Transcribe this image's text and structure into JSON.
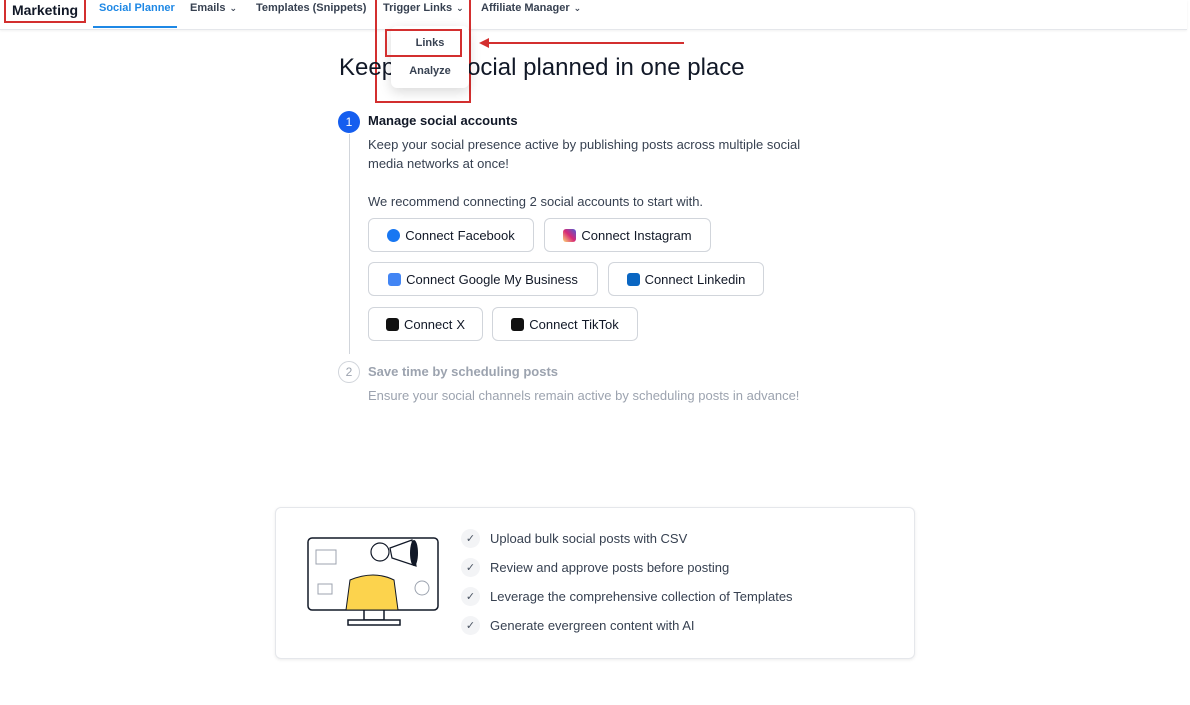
{
  "nav": {
    "brand": "Marketing",
    "items": [
      {
        "label": "Social Planner",
        "active": true
      },
      {
        "label": "Emails",
        "has_chevron": true
      },
      {
        "label": "Templates (Snippets)"
      },
      {
        "label": "Trigger Links",
        "has_chevron": true
      },
      {
        "label": "Affiliate Manager",
        "has_chevron": true
      }
    ],
    "dropdown": [
      "Links",
      "Analyze"
    ]
  },
  "page": {
    "heading": "Keep your social planned in one place"
  },
  "step1": {
    "number": "1",
    "title": "Manage social accounts",
    "desc_line1": "Keep your social presence active by publishing posts across multiple social",
    "desc_line2": "media networks at once!",
    "recommend": "We recommend connecting 2 social accounts to start with.",
    "buttons": [
      {
        "prefix": "Connect",
        "name": "Facebook",
        "icon": "facebook-icon"
      },
      {
        "prefix": "Connect",
        "name": "Instagram",
        "icon": "instagram-icon"
      },
      {
        "prefix": "Connect",
        "name": "Google My Business",
        "icon": "google-my-business-icon"
      },
      {
        "prefix": "Connect",
        "name": "Linkedin",
        "icon": "linkedin-icon"
      },
      {
        "prefix": "Connect",
        "name": "X",
        "icon": "x-icon"
      },
      {
        "prefix": "Connect",
        "name": "TikTok",
        "icon": "tiktok-icon"
      }
    ]
  },
  "step2": {
    "number": "2",
    "title": "Save time by scheduling posts",
    "desc": "Ensure your social channels remain active by scheduling posts in advance!"
  },
  "features": [
    "Upload bulk social posts with CSV",
    "Review and approve posts before posting",
    "Leverage the comprehensive collection of Templates",
    "Generate evergreen content with AI"
  ],
  "colors": {
    "accent": "#155eef",
    "nav_active": "#1e88e5",
    "annotation_red": "#d32f2f",
    "facebook": "#1877f2",
    "linkedin": "#0a66c2"
  }
}
